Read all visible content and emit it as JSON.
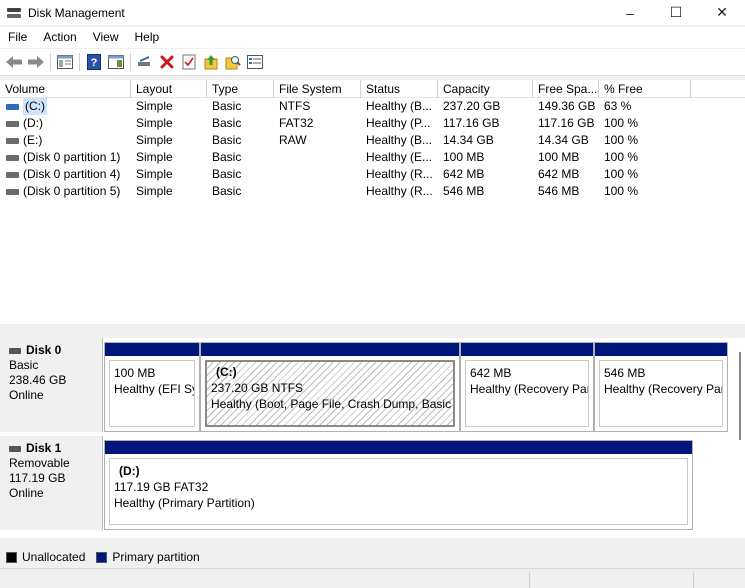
{
  "window": {
    "title": "Disk Management",
    "controls": [
      "–",
      "☐",
      "✕"
    ]
  },
  "menu": [
    "File",
    "Action",
    "View",
    "Help"
  ],
  "toolbar": [
    "back-icon",
    "forward-icon",
    "show-hide-console-tree-icon",
    "help-icon",
    "show-hide-action-pane-icon",
    "connect-drive-icon",
    "delete-icon",
    "properties-icon",
    "up-icon",
    "search-icon",
    "details-view-icon"
  ],
  "columns": [
    "Volume",
    "Layout",
    "Type",
    "File System",
    "Status",
    "Capacity",
    "Free Spa...",
    "% Free"
  ],
  "volumes": [
    {
      "volume": "(C:)",
      "layout": "Simple",
      "type": "Basic",
      "fs": "NTFS",
      "status": "Healthy (B...",
      "capacity": "237.20 GB",
      "free": "149.36 GB",
      "pct": "63 %"
    },
    {
      "volume": "(D:)",
      "layout": "Simple",
      "type": "Basic",
      "fs": "FAT32",
      "status": "Healthy (P...",
      "capacity": "117.16 GB",
      "free": "117.16 GB",
      "pct": "100 %"
    },
    {
      "volume": "(E:)",
      "layout": "Simple",
      "type": "Basic",
      "fs": "RAW",
      "status": "Healthy (B...",
      "capacity": "14.34 GB",
      "free": "14.34 GB",
      "pct": "100 %"
    },
    {
      "volume": "(Disk 0 partition 1)",
      "layout": "Simple",
      "type": "Basic",
      "fs": "",
      "status": "Healthy (E...",
      "capacity": "100 MB",
      "free": "100 MB",
      "pct": "100 %"
    },
    {
      "volume": "(Disk 0 partition 4)",
      "layout": "Simple",
      "type": "Basic",
      "fs": "",
      "status": "Healthy (R...",
      "capacity": "642 MB",
      "free": "642 MB",
      "pct": "100 %"
    },
    {
      "volume": "(Disk 0 partition 5)",
      "layout": "Simple",
      "type": "Basic",
      "fs": "",
      "status": "Healthy (R...",
      "capacity": "546 MB",
      "free": "546 MB",
      "pct": "100 %"
    }
  ],
  "disks": [
    {
      "name": "Disk 0",
      "type": "Basic",
      "size": "238.46 GB",
      "state": "Online",
      "partitions": [
        {
          "name": "",
          "line1": "100 MB",
          "line2": "Healthy (EFI System Partition)"
        },
        {
          "name": "(C:)",
          "line1": "237.20 GB NTFS",
          "line2": "Healthy (Boot, Page File, Crash Dump, Basic Data Partition)"
        },
        {
          "name": "",
          "line1": "642 MB",
          "line2": "Healthy (Recovery Partition)"
        },
        {
          "name": "",
          "line1": "546 MB",
          "line2": "Healthy (Recovery Partition)"
        }
      ]
    },
    {
      "name": "Disk 1",
      "type": "Removable",
      "size": "117.19 GB",
      "state": "Online",
      "partitions": [
        {
          "name": "(D:)",
          "line1": "117.19 GB FAT32",
          "line2": "Healthy (Primary Partition)"
        }
      ]
    }
  ],
  "legend": [
    {
      "label": "Unallocated",
      "color": "#000000"
    },
    {
      "label": "Primary partition",
      "color": "#00167a"
    }
  ]
}
